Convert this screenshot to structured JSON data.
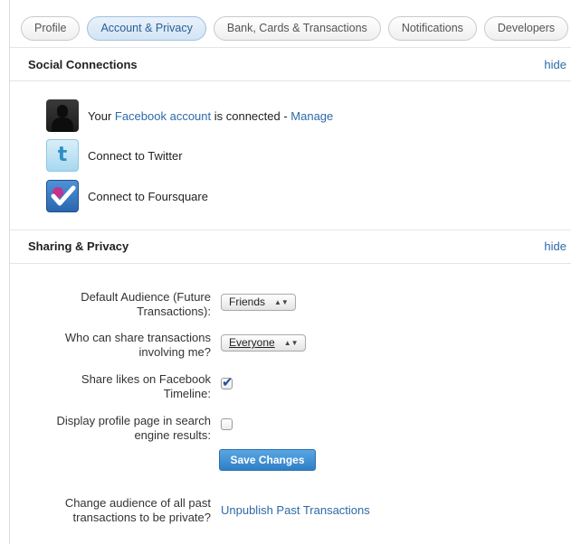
{
  "tabs": [
    {
      "label": "Profile",
      "active": false
    },
    {
      "label": "Account & Privacy",
      "active": true
    },
    {
      "label": "Bank, Cards & Transactions",
      "active": false
    },
    {
      "label": "Notifications",
      "active": false
    },
    {
      "label": "Developers",
      "active": false
    }
  ],
  "social": {
    "title": "Social Connections",
    "hide_label": "hide",
    "facebook": {
      "prefix": "Your ",
      "link": "Facebook account",
      "middle": " is connected - ",
      "manage": "Manage",
      "icon": "facebook-avatar-icon"
    },
    "twitter": {
      "link": "Connect to Twitter",
      "icon": "twitter-icon"
    },
    "foursquare": {
      "link": "Connect to Foursquare",
      "icon": "foursquare-icon"
    }
  },
  "sharing": {
    "title": "Sharing & Privacy",
    "hide_label": "hide",
    "default_audience": {
      "label_line1": "Default Audience (Future",
      "label_line2": "Transactions):",
      "value": "Friends"
    },
    "who_can_share": {
      "label_line1": "Who can share transactions",
      "label_line2": "involving me?",
      "value": "Everyone"
    },
    "share_likes": {
      "label_line1": "Share likes on Facebook",
      "label_line2": "Timeline:",
      "checked": true
    },
    "display_profile": {
      "label_line1": "Display profile page in search",
      "label_line2": "engine results:",
      "checked": false
    },
    "save_label": "Save Changes",
    "past_audience": {
      "label_line1": "Change audience of all past",
      "label_line2": "transactions to be private?",
      "link": "Unpublish Past Transactions"
    }
  },
  "colors": {
    "link": "#2d6aa8",
    "accent": "#2f7fc6"
  }
}
